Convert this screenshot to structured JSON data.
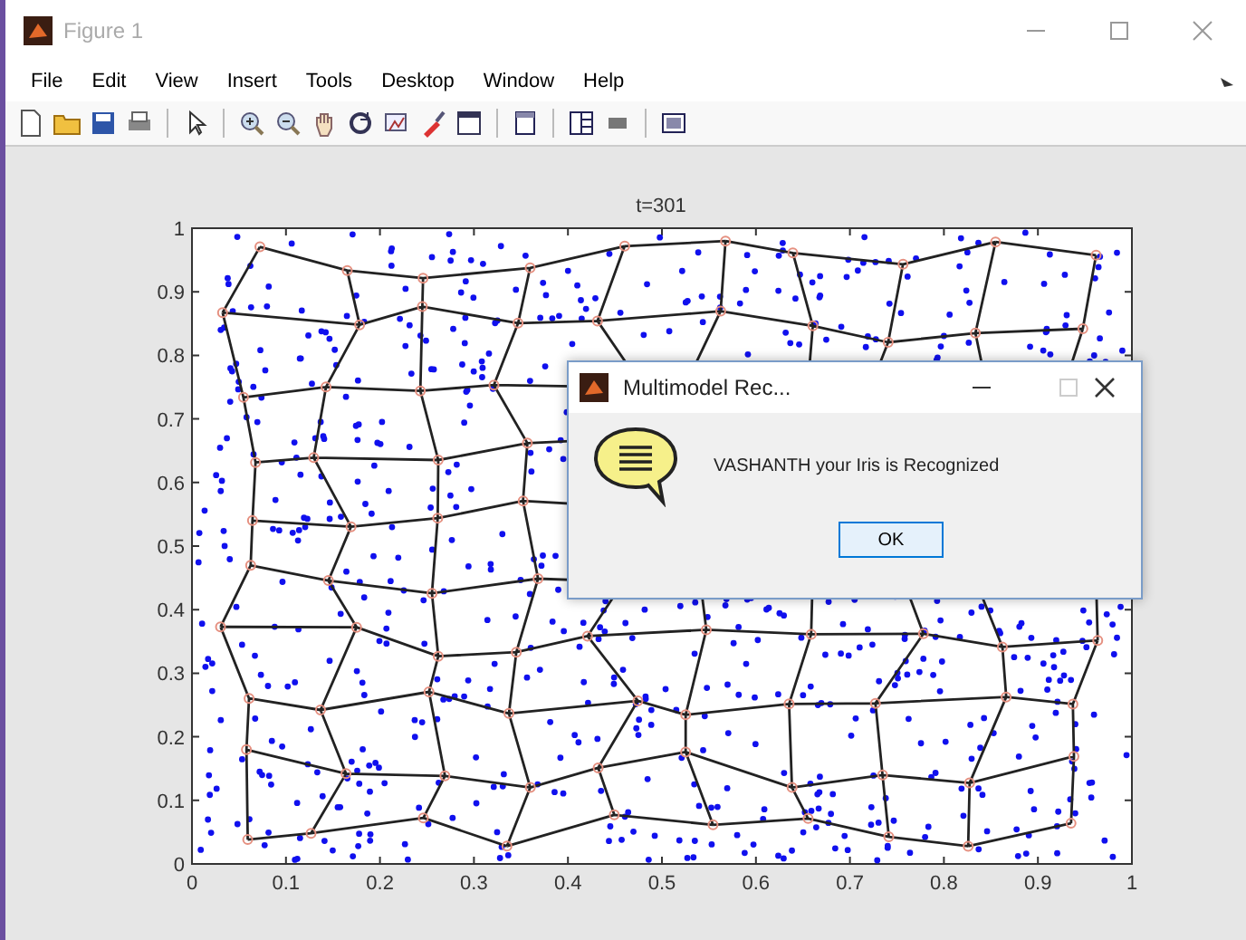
{
  "window": {
    "title": "Figure 1"
  },
  "menu": [
    "File",
    "Edit",
    "View",
    "Insert",
    "Tools",
    "Desktop",
    "Window",
    "Help"
  ],
  "plot": {
    "title": "t=301",
    "xticks": [
      "0",
      "0.1",
      "0.2",
      "0.3",
      "0.4",
      "0.5",
      "0.6",
      "0.7",
      "0.8",
      "0.9",
      "1"
    ],
    "yticks": [
      "1",
      "0.9",
      "0.8",
      "0.7",
      "0.6",
      "0.5",
      "0.4",
      "0.3",
      "0.2",
      "0.1",
      "0"
    ]
  },
  "dialog": {
    "title": "Multimodel Rec...",
    "message": "VASHANTH your Iris is Recognized",
    "button": "OK"
  }
}
